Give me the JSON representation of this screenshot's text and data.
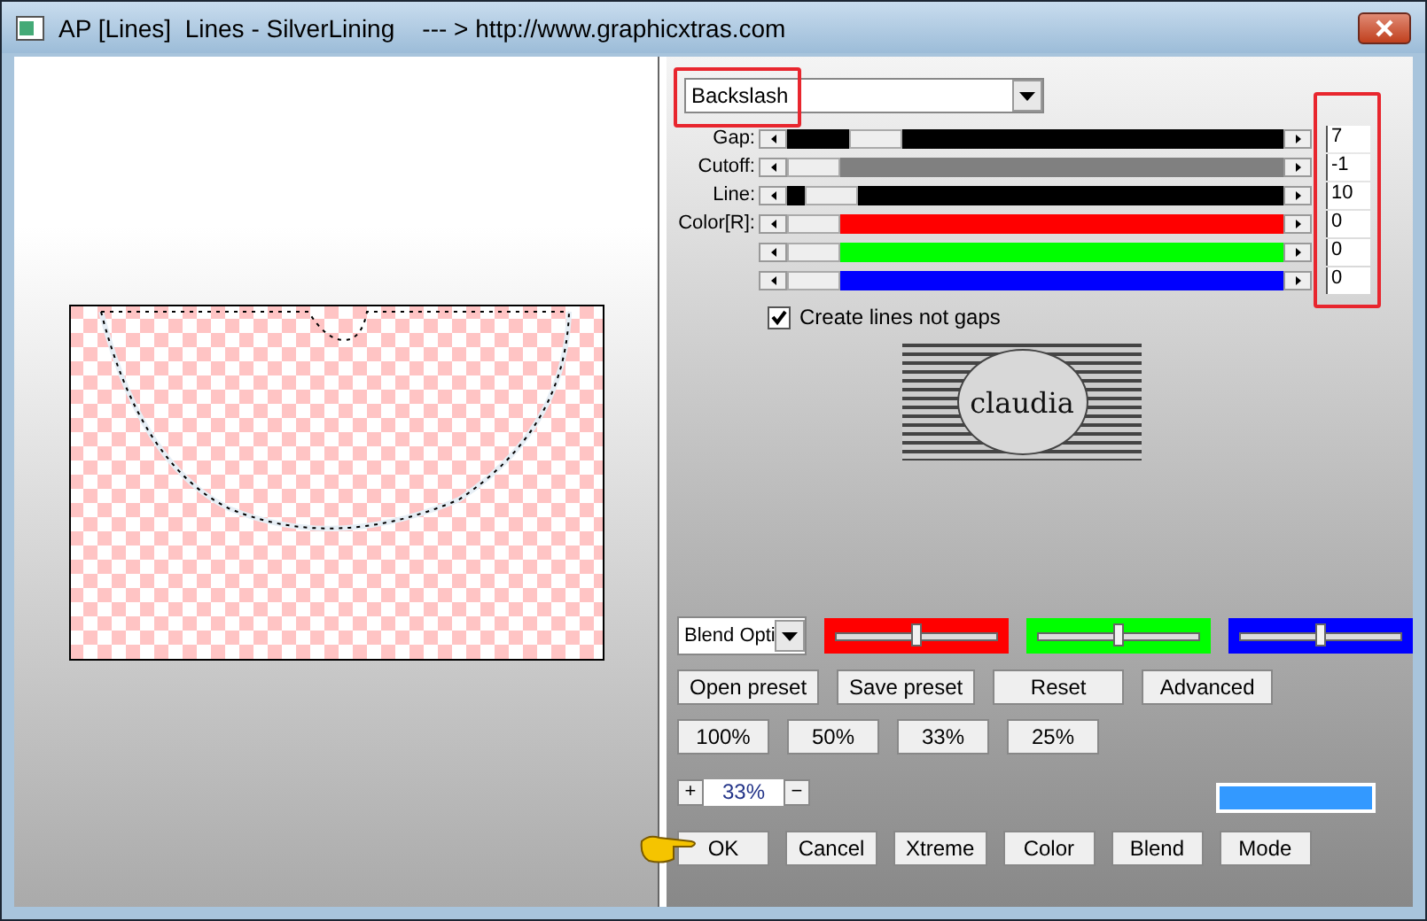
{
  "window": {
    "title": "AP [Lines]  Lines - SilverLining    --- > http://www.graphicxtras.com"
  },
  "pattern_dropdown": {
    "value": "Backslash"
  },
  "sliders": [
    {
      "label": "Gap:",
      "level": 0.14,
      "color": "#000000",
      "value": "7"
    },
    {
      "label": "Cutoff:",
      "level": 0,
      "color": "#808080",
      "value": "-1"
    },
    {
      "label": "Line:",
      "level": 0.04,
      "color": "#000000",
      "value": "10"
    },
    {
      "label": "Color[R]:",
      "level": 0,
      "color": "#ff0000",
      "value": "0"
    },
    {
      "level": 0,
      "color": "#00ff00",
      "value": "0"
    },
    {
      "level": 0,
      "color": "#0000ff",
      "value": "0"
    }
  ],
  "create_lines_checkbox": {
    "label": "Create lines not gaps",
    "checked": true
  },
  "logo": {
    "text": "claudia"
  },
  "blend_dropdown": {
    "value": "Blend Opti"
  },
  "blend_sliders": [
    {
      "level": 0.5,
      "color": "#ff0000"
    },
    {
      "level": 0.5,
      "color": "#00ff00"
    },
    {
      "level": 0.5,
      "color": "#0000ff"
    }
  ],
  "preset_buttons": [
    "Open preset",
    "Save preset",
    "Reset",
    "Advanced"
  ],
  "zoom_buttons": [
    "100%",
    "50%",
    "33%",
    "25%"
  ],
  "zoom": {
    "plus": "+",
    "value": "33%",
    "minus": "−"
  },
  "color_swatch": {
    "color": "#3399ff"
  },
  "bottom_buttons": [
    "OK",
    "Cancel",
    "Xtreme",
    "Color",
    "Blend",
    "Mode"
  ]
}
